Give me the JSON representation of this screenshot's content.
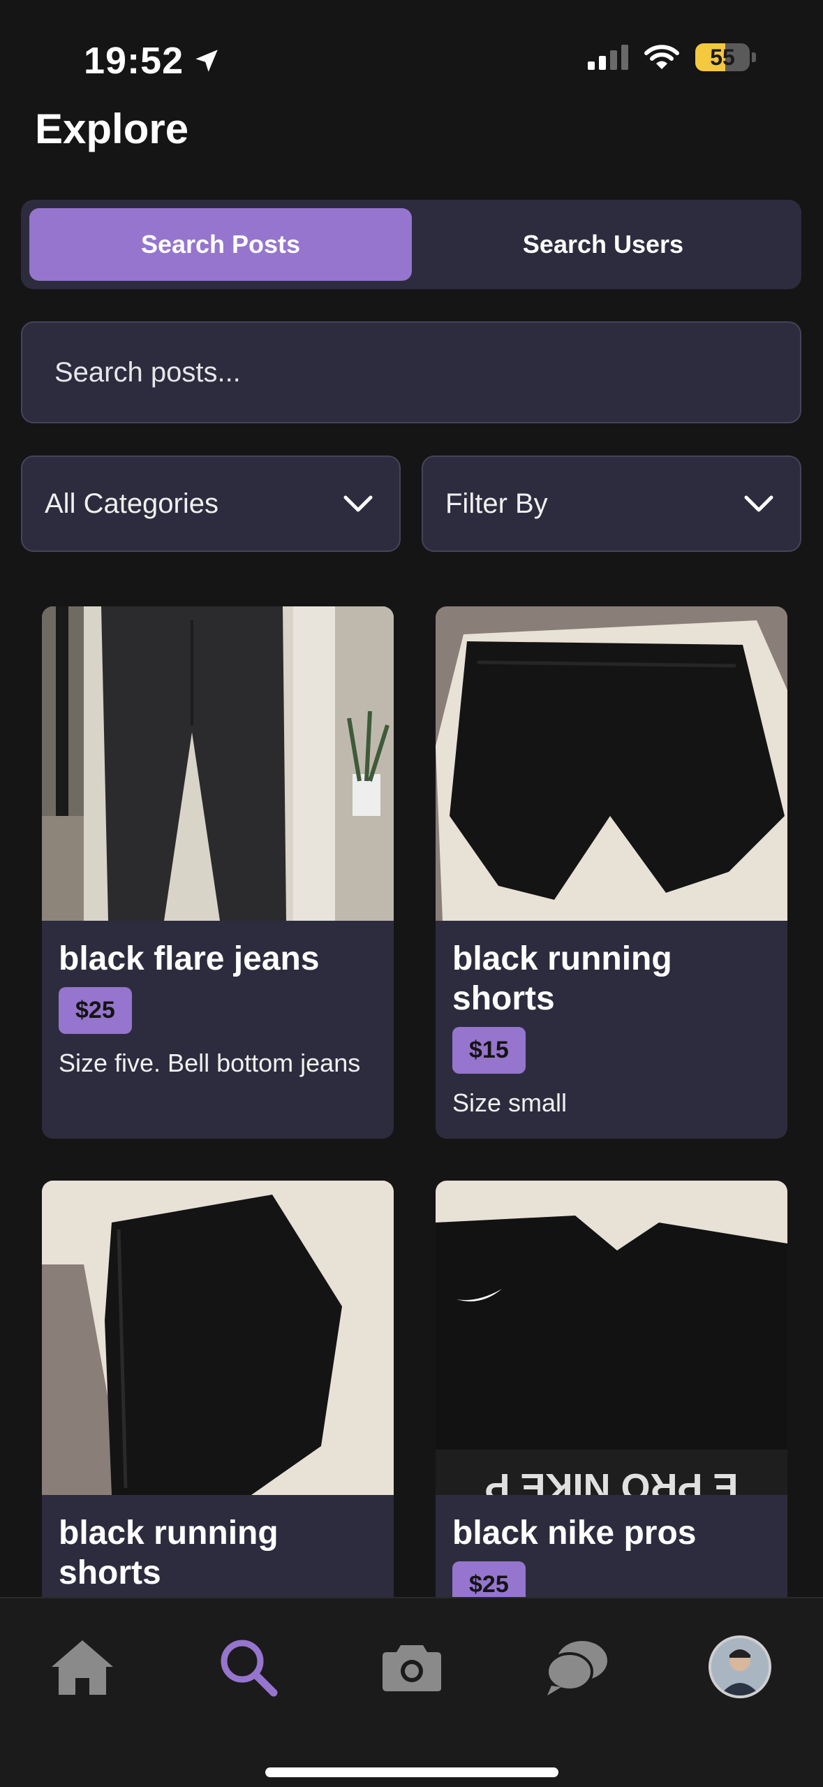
{
  "status_bar": {
    "time": "19:52",
    "battery": "55",
    "battery_level": 0.55
  },
  "header": {
    "title": "Explore"
  },
  "segmented_control": {
    "tabs": [
      {
        "label": "Search Posts",
        "active": true
      },
      {
        "label": "Search Users",
        "active": false
      }
    ]
  },
  "search": {
    "placeholder": "Search posts..."
  },
  "filters": {
    "category": "All Categories",
    "filter_by": "Filter By"
  },
  "posts": [
    {
      "title": "black flare jeans",
      "price": "$25",
      "description": "Size five. Bell bottom jeans"
    },
    {
      "title": "black running shorts",
      "price": "$15",
      "description": "Size small"
    },
    {
      "title": "black running shorts",
      "price": "",
      "description": ""
    },
    {
      "title": "black nike pros",
      "price": "$25",
      "description": ""
    }
  ],
  "image_text": {
    "waistband": "E PRO NIKE P"
  },
  "nav": {
    "items": [
      "home-icon",
      "search-icon",
      "camera-icon",
      "chat-icon",
      "profile-avatar"
    ],
    "active": "search-icon"
  },
  "colors": {
    "accent": "#9575cd",
    "background": "#151515",
    "surface": "#2d2c3e"
  }
}
